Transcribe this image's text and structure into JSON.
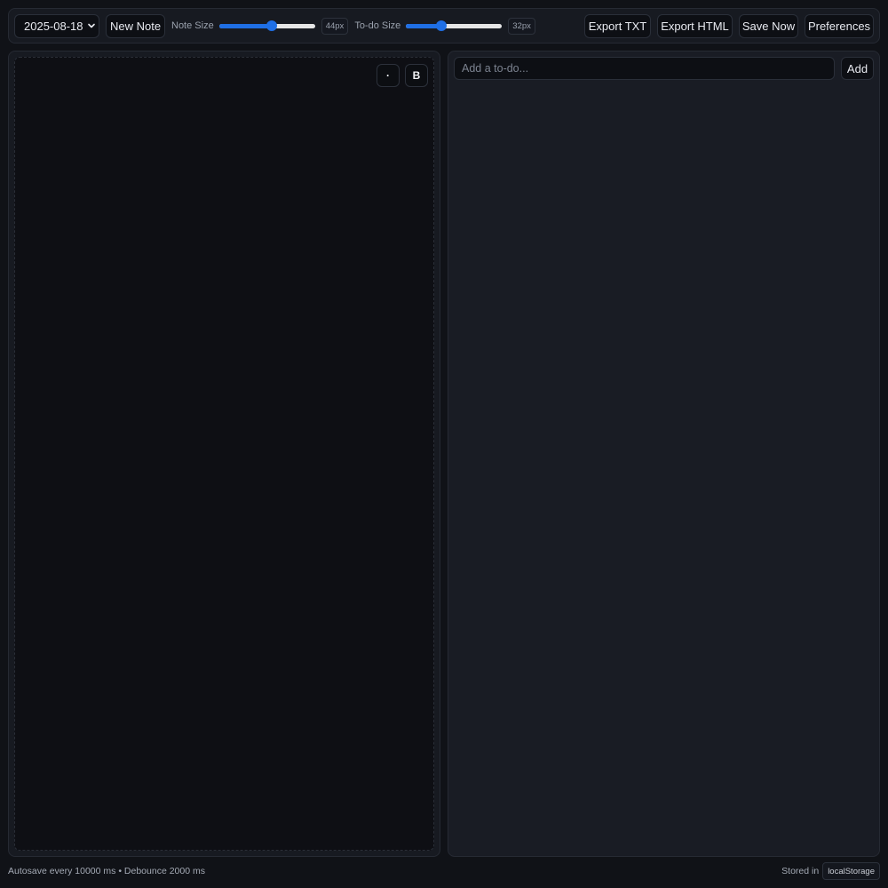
{
  "toolbar": {
    "date_value": "2025-08-18",
    "new_note_label": "New Note",
    "note_size": {
      "label": "Note Size",
      "value_text": "44px",
      "fraction": 0.55
    },
    "todo_size": {
      "label": "To-do Size",
      "value_text": "32px",
      "fraction": 0.37
    },
    "export_txt_label": "Export TXT",
    "export_html_label": "Export HTML",
    "save_now_label": "Save Now",
    "preferences_label": "Preferences"
  },
  "editor": {
    "bullet_button_label": "·",
    "bold_button_label": "B"
  },
  "todo": {
    "input_placeholder": "Add a to-do...",
    "add_label": "Add",
    "items": []
  },
  "footer": {
    "autosave_text": "Autosave every 10000 ms • Debounce 2000 ms",
    "stored_in_label": "Stored in",
    "storage_name": "localStorage"
  },
  "colors": {
    "accent": "#1f6fe5",
    "background": "#101217",
    "panel": "#171a21"
  }
}
